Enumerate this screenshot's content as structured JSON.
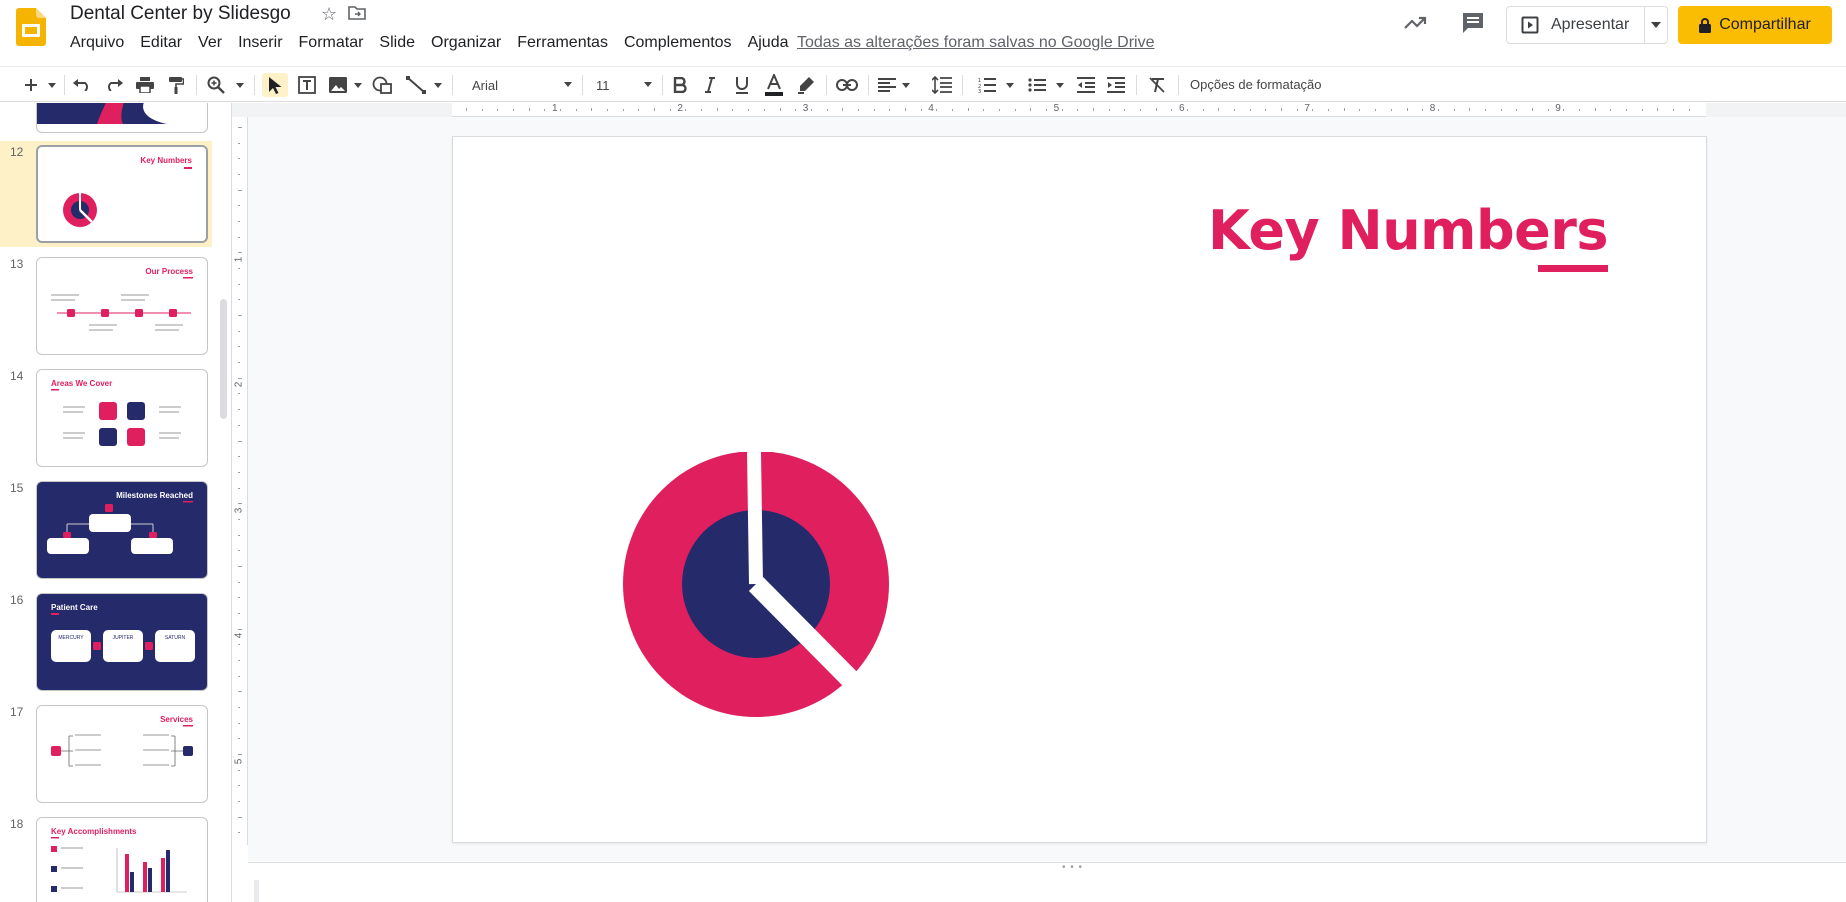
{
  "doc": {
    "title": "Dental Center by Slidesgo",
    "saved_status": "Todas as alterações foram salvas no Google Drive"
  },
  "menu": [
    "Arquivo",
    "Editar",
    "Ver",
    "Inserir",
    "Formatar",
    "Slide",
    "Organizar",
    "Ferramentas",
    "Complementos",
    "Ajuda"
  ],
  "header": {
    "present_label": "Apresentar",
    "share_label": "Compartilhar"
  },
  "toolbar": {
    "font": "Arial",
    "font_size": "11",
    "format_options": "Opções de formatação"
  },
  "ruler": {
    "h": [
      "1",
      "2",
      "3",
      "4",
      "5",
      "6",
      "7",
      "8",
      "9"
    ],
    "v": [
      "1",
      "2",
      "3",
      "4",
      "5"
    ]
  },
  "slides": [
    {
      "num": "12",
      "title": "Key Numbers",
      "active": true
    },
    {
      "num": "13",
      "title": "Our Process"
    },
    {
      "num": "14",
      "title": "Areas We Cover"
    },
    {
      "num": "15",
      "title": "Milestones Reached"
    },
    {
      "num": "16",
      "title": "Patient Care",
      "labels": [
        "MERCURY",
        "JUPITER",
        "SATURN"
      ]
    },
    {
      "num": "17",
      "title": "Services"
    },
    {
      "num": "18",
      "title": "Key Accomplishments"
    }
  ],
  "main_slide": {
    "title": "Key Numbers"
  },
  "colors": {
    "accent": "#e01f5f",
    "navy": "#252a6a",
    "share": "#fbbc04"
  }
}
